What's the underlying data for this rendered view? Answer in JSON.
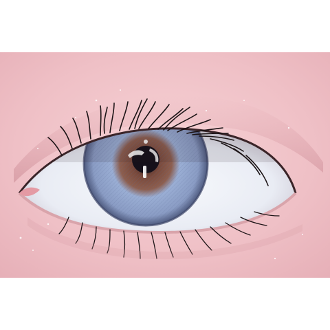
{
  "image": {
    "subject": "eye-closeup",
    "colors": {
      "background": "#ffffff",
      "skin": "#f0c4c9",
      "skin_shadow": "#d99aa3",
      "sclera": "#f4f6fb",
      "iris_outer": "#8a9cc4",
      "iris_mid": "#9aaed4",
      "iris_inner": "#7a4a3c",
      "pupil": "#15101a",
      "lash": "#1c1416"
    }
  }
}
